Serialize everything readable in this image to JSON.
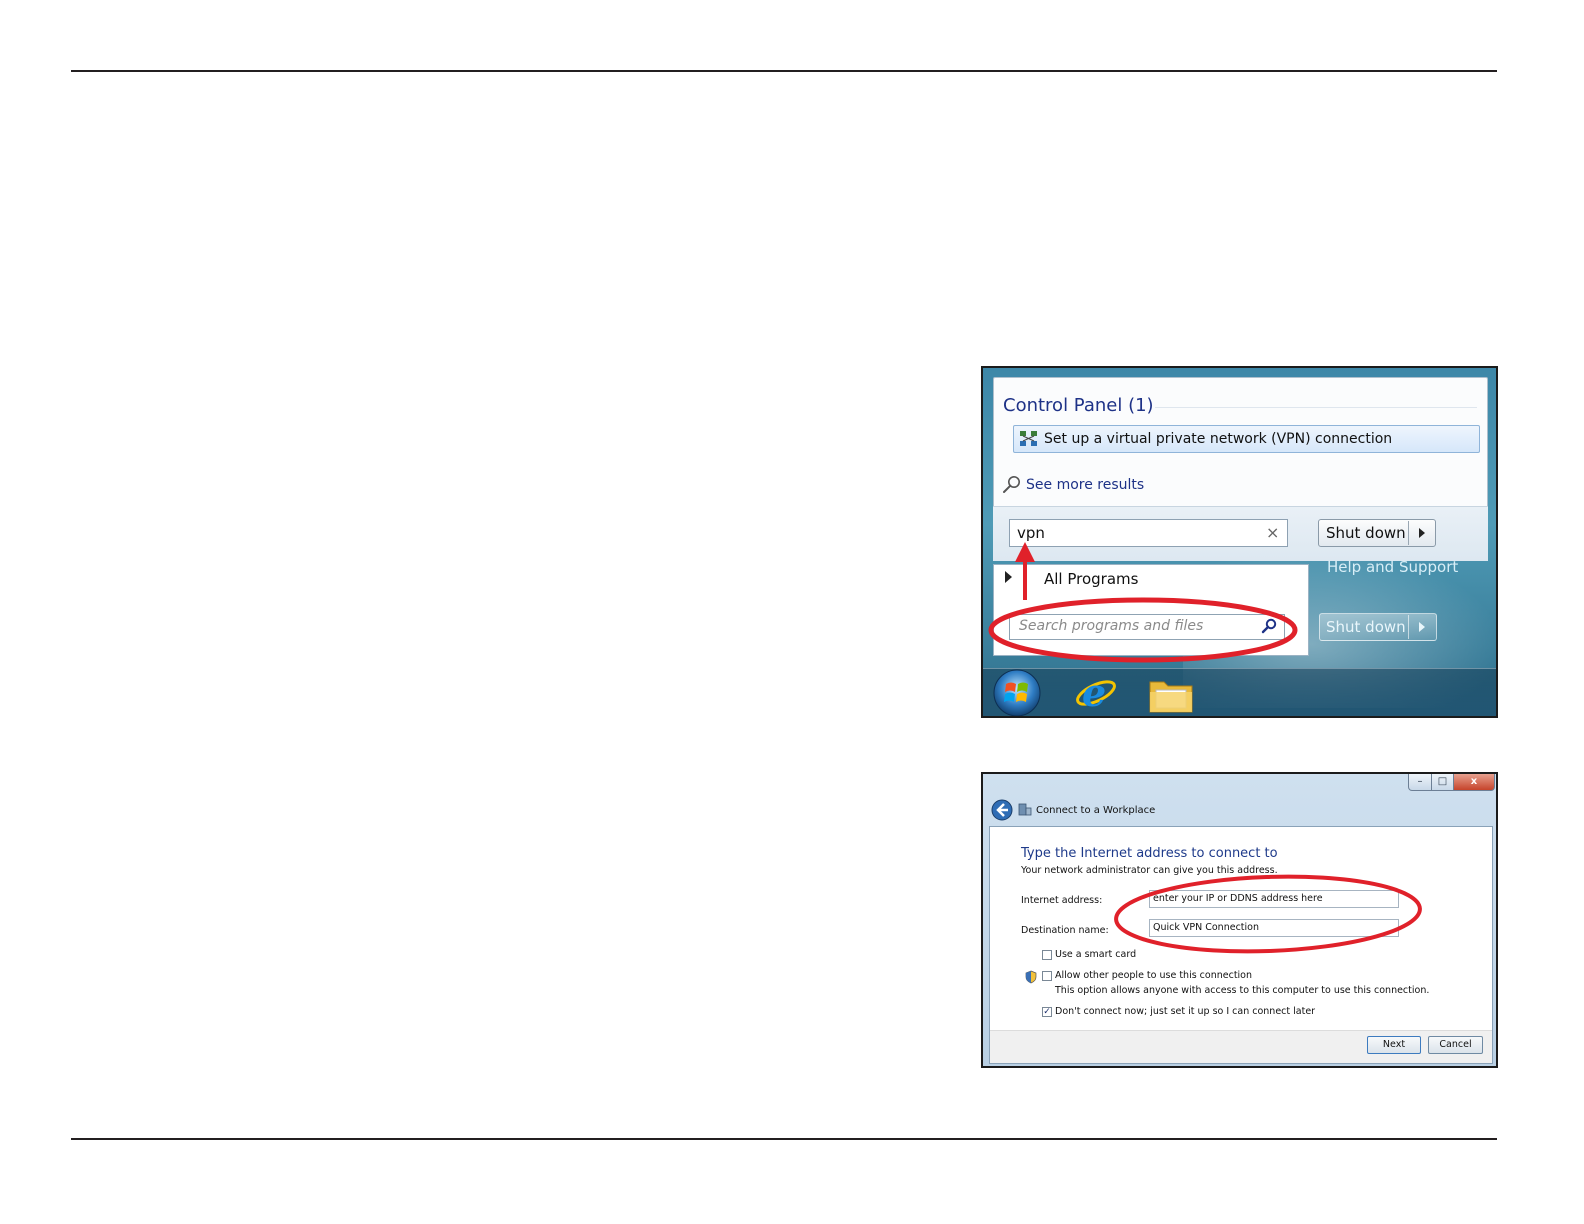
{
  "start_menu": {
    "category_header": "Control Panel (1)",
    "vpn_result_label": "Set up a virtual private network (VPN) connection",
    "see_more_label": "See more results",
    "search_value": "vpn",
    "shutdown_label": "Shut down",
    "all_programs_label": "All Programs",
    "search_placeholder": "Search programs and files",
    "help_support_label": "Help and Support",
    "annotation_color": "#e0212a"
  },
  "vpn_wizard": {
    "window_title": "Connect to a Workplace",
    "heading": "Type the Internet address to connect to",
    "subheading": "Your network administrator can give you this address.",
    "internet_address_label": "Internet address:",
    "internet_address_value": "enter your IP or DDNS address here",
    "destination_name_label": "Destination name:",
    "destination_name_value": "Quick VPN Connection",
    "options": [
      {
        "label": "Use a smart card",
        "checked": false
      },
      {
        "label": "Allow other people to use this connection",
        "checked": false,
        "note": "This option allows anyone with access to this computer to use this connection."
      },
      {
        "label": "Don't connect now; just set it up so I can connect later",
        "checked": true
      }
    ],
    "next_label": "Next",
    "cancel_label": "Cancel",
    "minimize_glyph": "–",
    "maximize_glyph": "□",
    "close_glyph": "x",
    "annotation_color": "#e0212a"
  }
}
